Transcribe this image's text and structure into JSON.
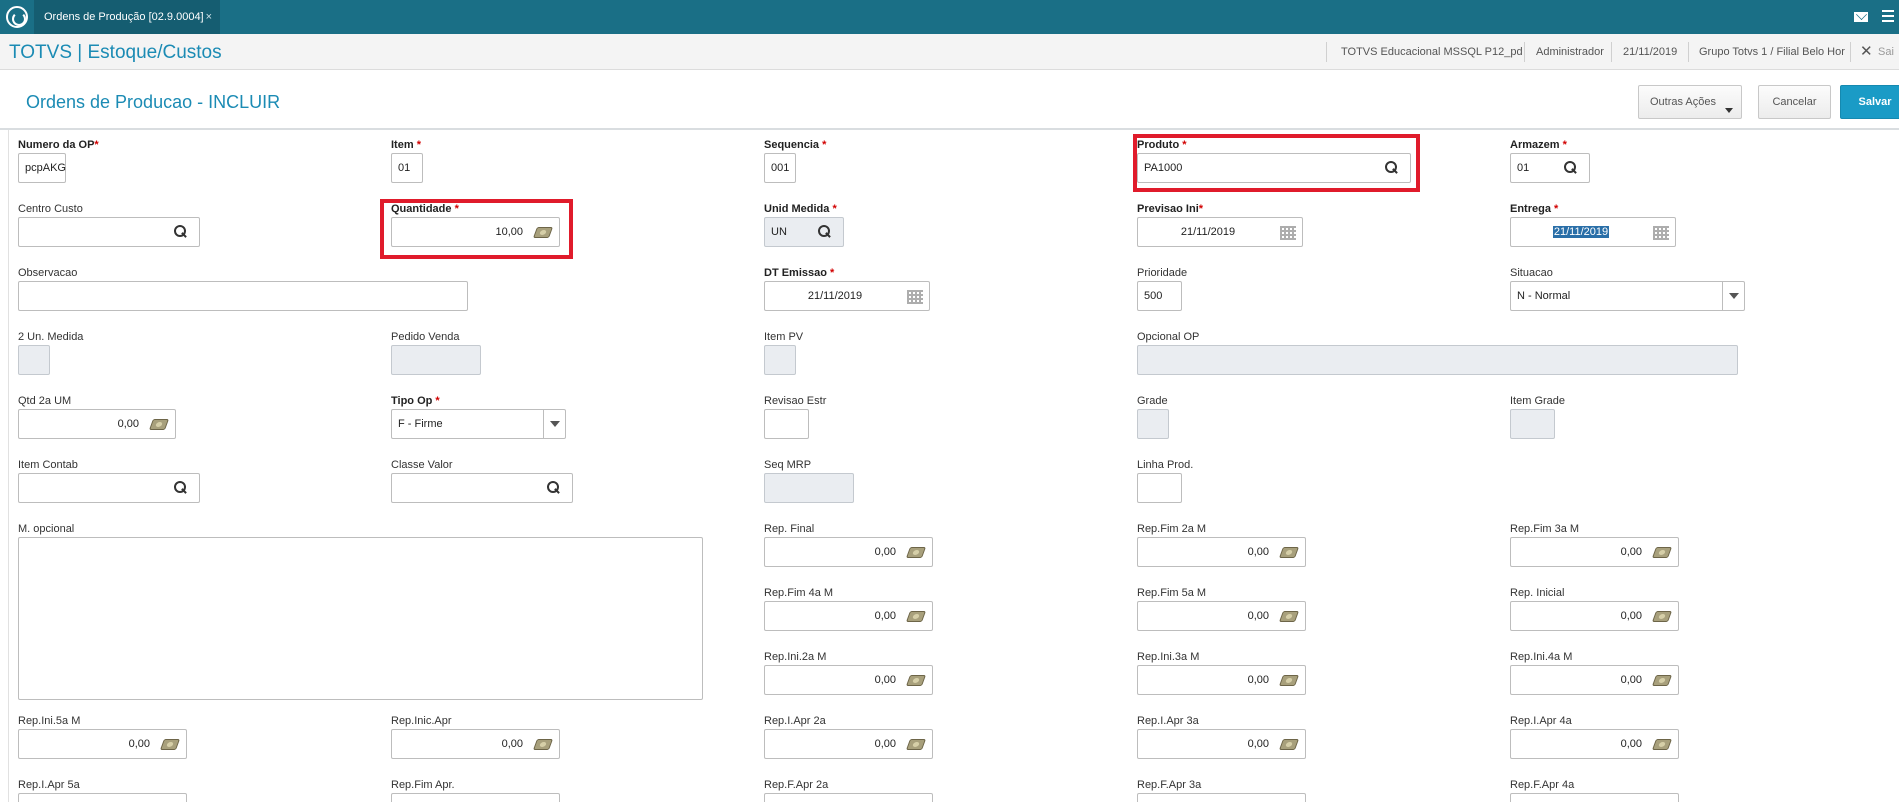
{
  "tab": {
    "title": "Ordens de Produção [02.9.0004]",
    "close": "×"
  },
  "header": {
    "brand": "TOTVS | Estoque/Custos",
    "env": "TOTVS Educacional MSSQL P12_pd",
    "user": "Administrador",
    "date": "21/11/2019",
    "branch": "Grupo Totvs 1 / Filial Belo Hor",
    "close": "✕",
    "exit": "Sai"
  },
  "page": {
    "title": "Ordens de Producao - INCLUIR"
  },
  "actions": {
    "other": "Outras Ações",
    "cancel": "Cancelar",
    "save": "Salvar"
  },
  "required_star": "*",
  "fields": {
    "numero_op": {
      "label": "Numero da OP",
      "value": "pcpAKG"
    },
    "item": {
      "label": "Item",
      "value": "01"
    },
    "sequencia": {
      "label": "Sequencia",
      "value": "001"
    },
    "produto": {
      "label": "Produto",
      "value": "PA1000"
    },
    "armazem": {
      "label": "Armazem",
      "value": "01"
    },
    "centro_custo": {
      "label": "Centro Custo",
      "value": ""
    },
    "quantidade": {
      "label": "Quantidade",
      "value": "10,00"
    },
    "unid_medida": {
      "label": "Unid Medida",
      "value": "UN"
    },
    "previsao_ini": {
      "label": "Previsao Ini",
      "value": "21/11/2019"
    },
    "entrega": {
      "label": "Entrega",
      "value": "21/11/2019"
    },
    "observacao": {
      "label": "Observacao",
      "value": ""
    },
    "dt_emissao": {
      "label": "DT Emissao",
      "value": "21/11/2019"
    },
    "prioridade": {
      "label": "Prioridade",
      "value": "500"
    },
    "situacao": {
      "label": "Situacao",
      "value": "N - Normal"
    },
    "un_medida_2": {
      "label": "2 Un. Medida",
      "value": ""
    },
    "pedido_venda": {
      "label": "Pedido Venda",
      "value": ""
    },
    "item_pv": {
      "label": "Item PV",
      "value": ""
    },
    "opcional_op": {
      "label": "Opcional OP",
      "value": ""
    },
    "qtd_2a_um": {
      "label": "Qtd 2a UM",
      "value": "0,00"
    },
    "tipo_op": {
      "label": "Tipo Op",
      "value": "F - Firme"
    },
    "revisao_estr": {
      "label": "Revisao Estr",
      "value": ""
    },
    "grade": {
      "label": "Grade",
      "value": ""
    },
    "item_grade": {
      "label": "Item Grade",
      "value": ""
    },
    "item_contab": {
      "label": "Item Contab",
      "value": ""
    },
    "classe_valor": {
      "label": "Classe Valor",
      "value": ""
    },
    "seq_mrp": {
      "label": "Seq MRP",
      "value": ""
    },
    "linha_prod": {
      "label": "Linha Prod.",
      "value": ""
    },
    "m_opcional": {
      "label": "M. opcional",
      "value": ""
    },
    "rep_final": {
      "label": "Rep. Final",
      "value": "0,00"
    },
    "rep_fim_2a": {
      "label": "Rep.Fim 2a M",
      "value": "0,00"
    },
    "rep_fim_3a": {
      "label": "Rep.Fim 3a M",
      "value": "0,00"
    },
    "rep_fim_4a": {
      "label": "Rep.Fim 4a M",
      "value": "0,00"
    },
    "rep_fim_5a": {
      "label": "Rep.Fim 5a M",
      "value": "0,00"
    },
    "rep_inicial": {
      "label": "Rep. Inicial",
      "value": "0,00"
    },
    "rep_ini_2a": {
      "label": "Rep.Ini.2a M",
      "value": "0,00"
    },
    "rep_ini_3a": {
      "label": "Rep.Ini.3a M",
      "value": "0,00"
    },
    "rep_ini_4a": {
      "label": "Rep.Ini.4a M",
      "value": "0,00"
    },
    "rep_ini_5a": {
      "label": "Rep.Ini.5a M",
      "value": "0,00"
    },
    "rep_inic_apr": {
      "label": "Rep.Inic.Apr",
      "value": "0,00"
    },
    "rep_i_apr_2a": {
      "label": "Rep.I.Apr 2a",
      "value": "0,00"
    },
    "rep_i_apr_3a": {
      "label": "Rep.I.Apr 3a",
      "value": "0,00"
    },
    "rep_i_apr_4a": {
      "label": "Rep.I.Apr 4a",
      "value": "0,00"
    },
    "rep_i_apr_5a": {
      "label": "Rep.I.Apr 5a",
      "value": ""
    },
    "rep_fim_apr": {
      "label": "Rep.Fim Apr.",
      "value": ""
    },
    "rep_f_apr_2a": {
      "label": "Rep.F.Apr 2a",
      "value": ""
    },
    "rep_f_apr_3a": {
      "label": "Rep.F.Apr 3a",
      "value": ""
    },
    "rep_f_apr_4a": {
      "label": "Rep.F.Apr 4a",
      "value": ""
    }
  },
  "colors": {
    "topbar": "#1a6f86",
    "brand": "#1b8bb4",
    "primary": "#1a9bc6",
    "highlight": "#e01b2b",
    "required": "#d10000"
  }
}
